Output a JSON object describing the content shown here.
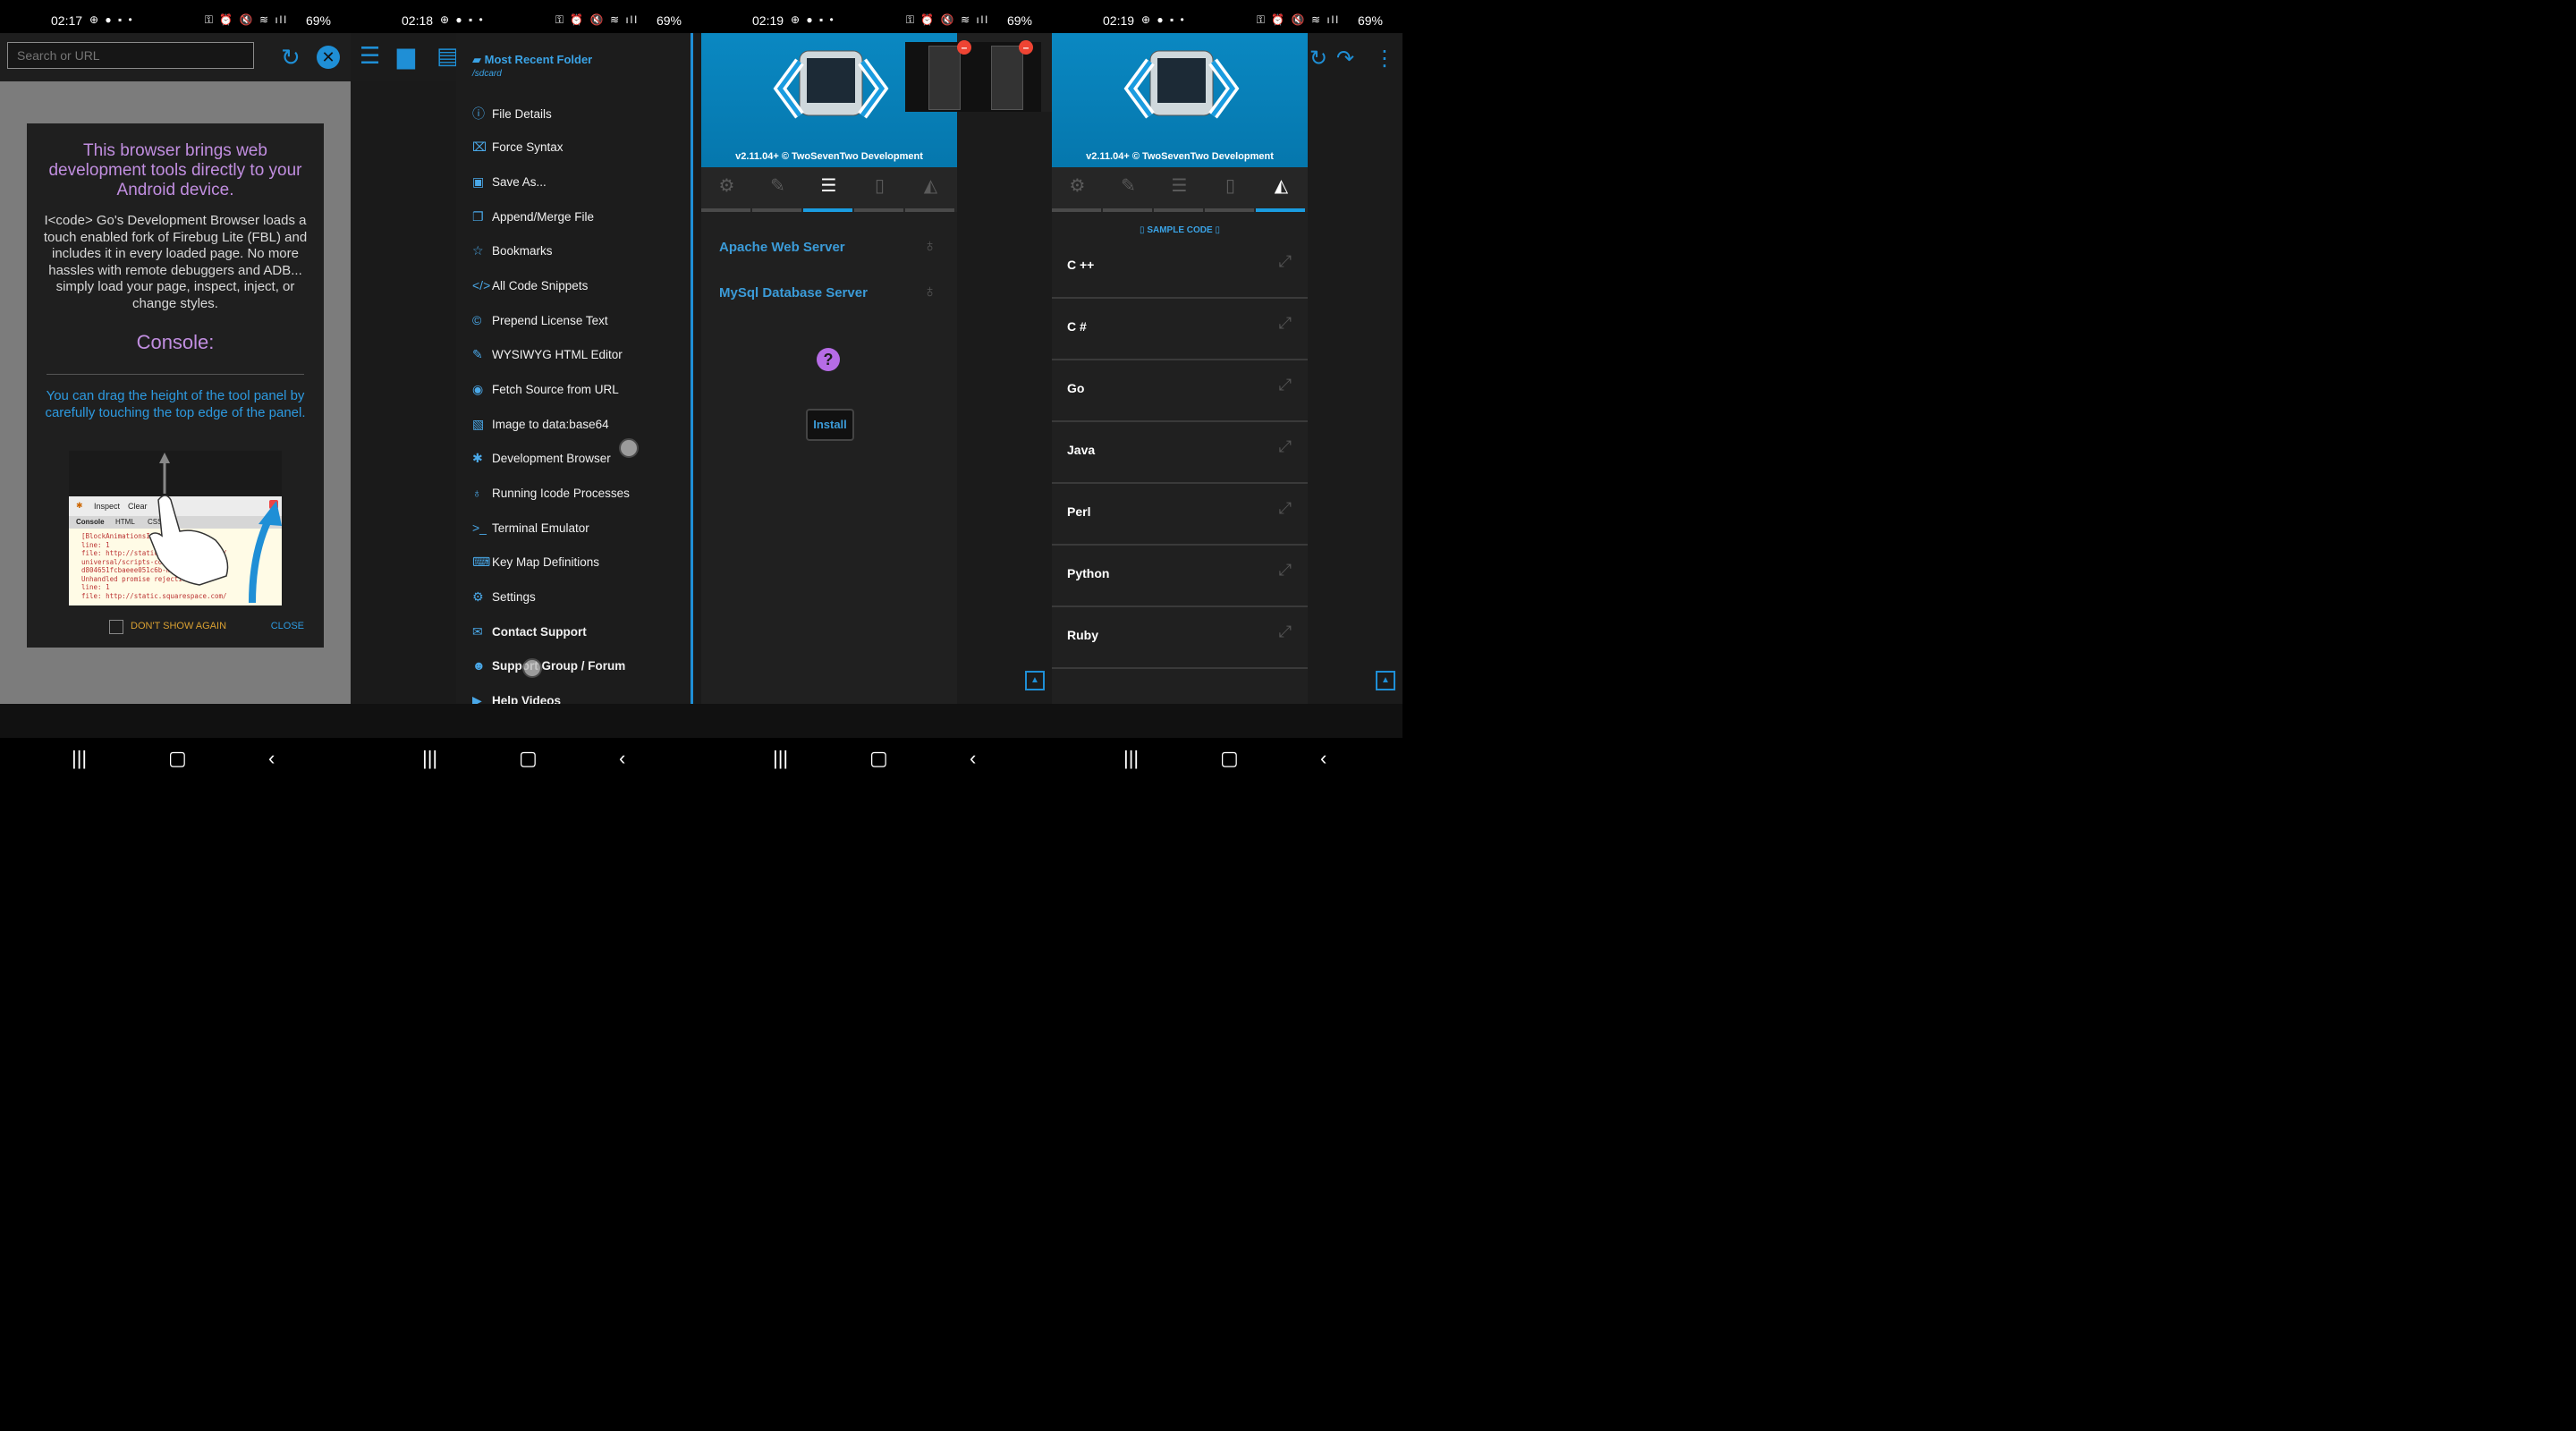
{
  "panels": [
    {
      "time": "02:17",
      "battery": "69%",
      "url_placeholder": "Search or URL",
      "dialog": {
        "title": "This browser brings web development tools directly to your Android device.",
        "body": "I<code> Go's Development Browser loads a touch enabled fork of Firebug Lite (FBL) and includes it in every loaded page. No more hassles with remote debuggers and ADB... simply load your page, inspect, inject, or change styles.",
        "subtitle": "Console:",
        "hint": "You can drag the height of the tool panel by carefully touching the top edge of the panel.",
        "illustration": {
          "toolbar_inspect": "Inspect",
          "toolbar_clear": "Clear",
          "tab_console": "Console",
          "tab_html": "HTML",
          "tab_css": "CSS",
          "log_lines": [
            "[BlockAnimationsInit",
            "line: 1",
            "file: http://static.squarespace.com/",
            "universal/scripts-compressed/common-",
            "d804651fcbaeee051c6b-min.en-US.js",
            "Unhandled promise rejection",
            "line: 1",
            "file: http://static.squarespace.com/"
          ]
        },
        "dont_show": "DON'T SHOW AGAIN",
        "close": "CLOSE"
      }
    },
    {
      "time": "02:18",
      "battery": "69%",
      "folder_title": "Most Recent Folder",
      "folder_path": "/sdcard",
      "menu": [
        {
          "label": "File Details",
          "icon": "info-icon"
        },
        {
          "label": "Force Syntax",
          "icon": "syntax-icon"
        },
        {
          "label": "Save As...",
          "icon": "save-icon"
        },
        {
          "label": "Append/Merge File",
          "icon": "append-icon"
        },
        {
          "label": "Bookmarks",
          "icon": "star-icon"
        },
        {
          "label": "All Code Snippets",
          "icon": "code-icon"
        },
        {
          "label": "Prepend License Text",
          "icon": "copyright-icon"
        },
        {
          "label": "WYSIWYG HTML Editor",
          "icon": "edit-icon"
        },
        {
          "label": "Fetch Source from URL",
          "icon": "globe-icon"
        },
        {
          "label": "Image to data:base64",
          "icon": "image-icon"
        },
        {
          "label": "Development Browser",
          "icon": "bug-icon"
        },
        {
          "label": "Running Icode Processes",
          "icon": "bulb-icon"
        },
        {
          "label": "Terminal Emulator",
          "icon": "terminal-icon"
        },
        {
          "label": "Key Map Definitions",
          "icon": "keyboard-icon"
        },
        {
          "label": "Settings",
          "icon": "gear-icon"
        },
        {
          "label": "Contact Support",
          "icon": "mail-icon"
        },
        {
          "label": "Support Group / Forum",
          "icon": "group-icon"
        },
        {
          "label": "Help Videos",
          "icon": "video-icon"
        }
      ]
    },
    {
      "time": "02:19",
      "battery": "69%",
      "version": "v2.11.04+ © TwoSevenTwo Development",
      "servers": [
        "Apache Web Server",
        "MySql Database Server"
      ],
      "install": "Install"
    },
    {
      "time": "02:19",
      "battery": "69%",
      "version": "v2.11.04+ © TwoSevenTwo Development",
      "sample_code": "SAMPLE CODE",
      "languages": [
        "C ++",
        "C #",
        "Go",
        "Java",
        "Perl",
        "Python",
        "Ruby"
      ]
    }
  ]
}
